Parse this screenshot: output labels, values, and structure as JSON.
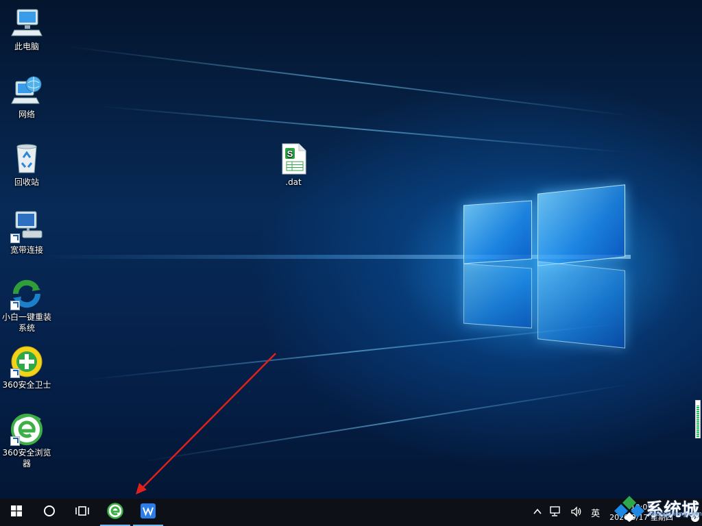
{
  "desktop": {
    "icons": [
      {
        "label": "此电脑",
        "icon": "computer-icon"
      },
      {
        "label": "网络",
        "icon": "network-icon"
      },
      {
        "label": "回收站",
        "icon": "recycle-bin-icon"
      },
      {
        "label": "宽带连接",
        "icon": "broadband-connection-icon"
      },
      {
        "label": "小白一键重装系统",
        "icon": "xiaobai-reinstall-icon"
      },
      {
        "label": "360安全卫士",
        "icon": "360-security-guard-icon"
      },
      {
        "label": "360安全浏览器",
        "icon": "360-browser-icon"
      }
    ],
    "file": {
      "label": ".dat",
      "icon": "spreadsheet-file-icon"
    }
  },
  "taskbar": {
    "start_icon": "windows-start-icon",
    "search_icon": "cortana-circle-icon",
    "task_view_icon": "task-view-icon",
    "pinned": [
      {
        "name": "360-browser",
        "icon": "360-browser-icon",
        "active": true
      },
      {
        "name": "wps-office",
        "icon": "wps-office-icon",
        "active": true
      }
    ]
  },
  "tray": {
    "chevron_icon": "chevron-up-icon",
    "network_icon": "network-tray-icon",
    "volume_icon": "speaker-icon",
    "ime": "英",
    "clock_time": "10:05",
    "clock_date": "2020/9/17 星期四",
    "notification_count": "7"
  },
  "watermark": {
    "text": "系统城",
    "sub": "xitongcheng.com"
  },
  "colors": {
    "accent": "#76b9ed",
    "arrow": "#e0211b",
    "taskbar": "#0d1016"
  }
}
